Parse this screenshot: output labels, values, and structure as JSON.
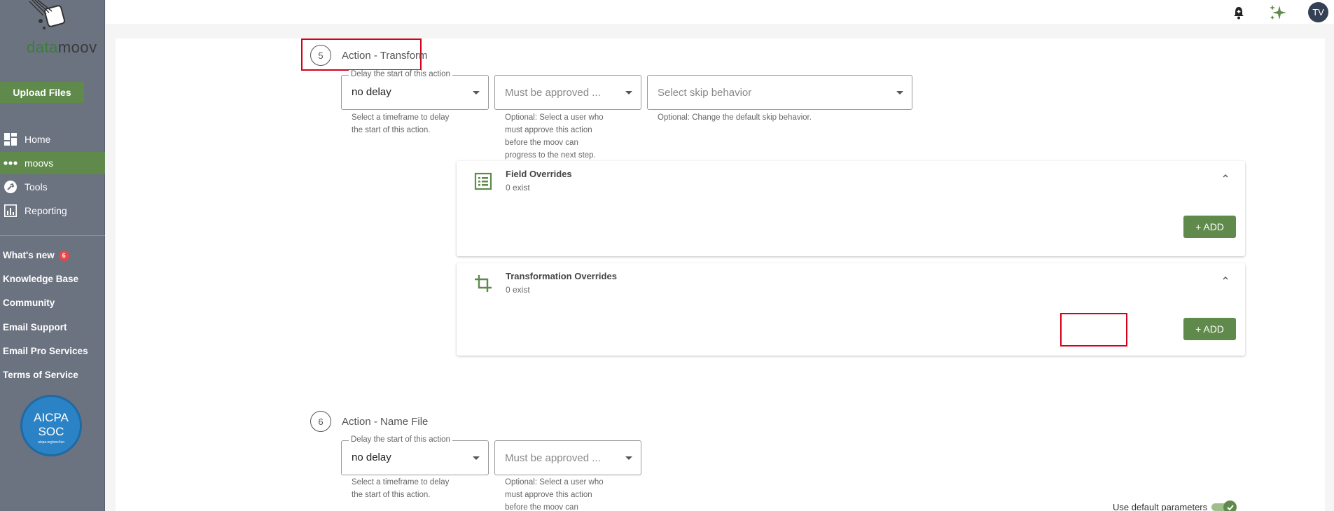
{
  "brand": {
    "logo_green": "data",
    "logo_dark": "moov",
    "accent": "#5f8a4b",
    "sidebar_bg": "#6b7280"
  },
  "sidebar": {
    "upload_label": "Upload Files",
    "nav": [
      {
        "label": "Home",
        "icon": "dashboard-icon"
      },
      {
        "label": "moovs",
        "icon": "dots-icon",
        "active": true
      },
      {
        "label": "Tools",
        "icon": "wrench-icon"
      },
      {
        "label": "Reporting",
        "icon": "chart-icon"
      }
    ],
    "links": [
      {
        "label": "What's new",
        "badge": "6"
      },
      {
        "label": "Knowledge Base"
      },
      {
        "label": "Community"
      },
      {
        "label": "Email Support"
      },
      {
        "label": "Email Pro Services"
      },
      {
        "label": "Terms of Service"
      }
    ],
    "aicpa": {
      "line1": "AICPA",
      "line2": "SOC",
      "line3": "aicpa.org/soc4so"
    }
  },
  "topbar": {
    "avatar": "TV",
    "icons": [
      "bell-icon",
      "sparkle-icon"
    ]
  },
  "steps": [
    {
      "number": "5",
      "title": "Action - Transform",
      "delay": {
        "legend": "Delay the start of this action",
        "value": "no delay",
        "help": [
          "Select a timeframe to delay",
          "the start of this action."
        ]
      },
      "approval": {
        "placeholder": "Must be approved ...",
        "help": [
          "Optional: Select a user who",
          "must approve this action",
          "before the moov can",
          "progress to the next step."
        ]
      },
      "skip": {
        "placeholder": "Select skip behavior",
        "help": [
          "Optional: Change the default skip behavior."
        ]
      },
      "panels": [
        {
          "title": "Field Overrides",
          "sub": "0 exist",
          "button": "+ ADD",
          "icon": "list-icon"
        },
        {
          "title": "Transformation Overrides",
          "sub": "0 exist",
          "button": "+ ADD",
          "icon": "crop-icon"
        }
      ]
    },
    {
      "number": "6",
      "title": "Action - Name File",
      "delay": {
        "legend": "Delay the start of this action",
        "value": "no delay",
        "help": [
          "Select a timeframe to delay",
          "the start of this action."
        ]
      },
      "approval": {
        "placeholder": "Must be approved ...",
        "help": [
          "Optional: Select a user who",
          "must approve this action",
          "before the moov can"
        ]
      },
      "toggle_label": "Use default parameters",
      "toggle_on": true
    }
  ]
}
